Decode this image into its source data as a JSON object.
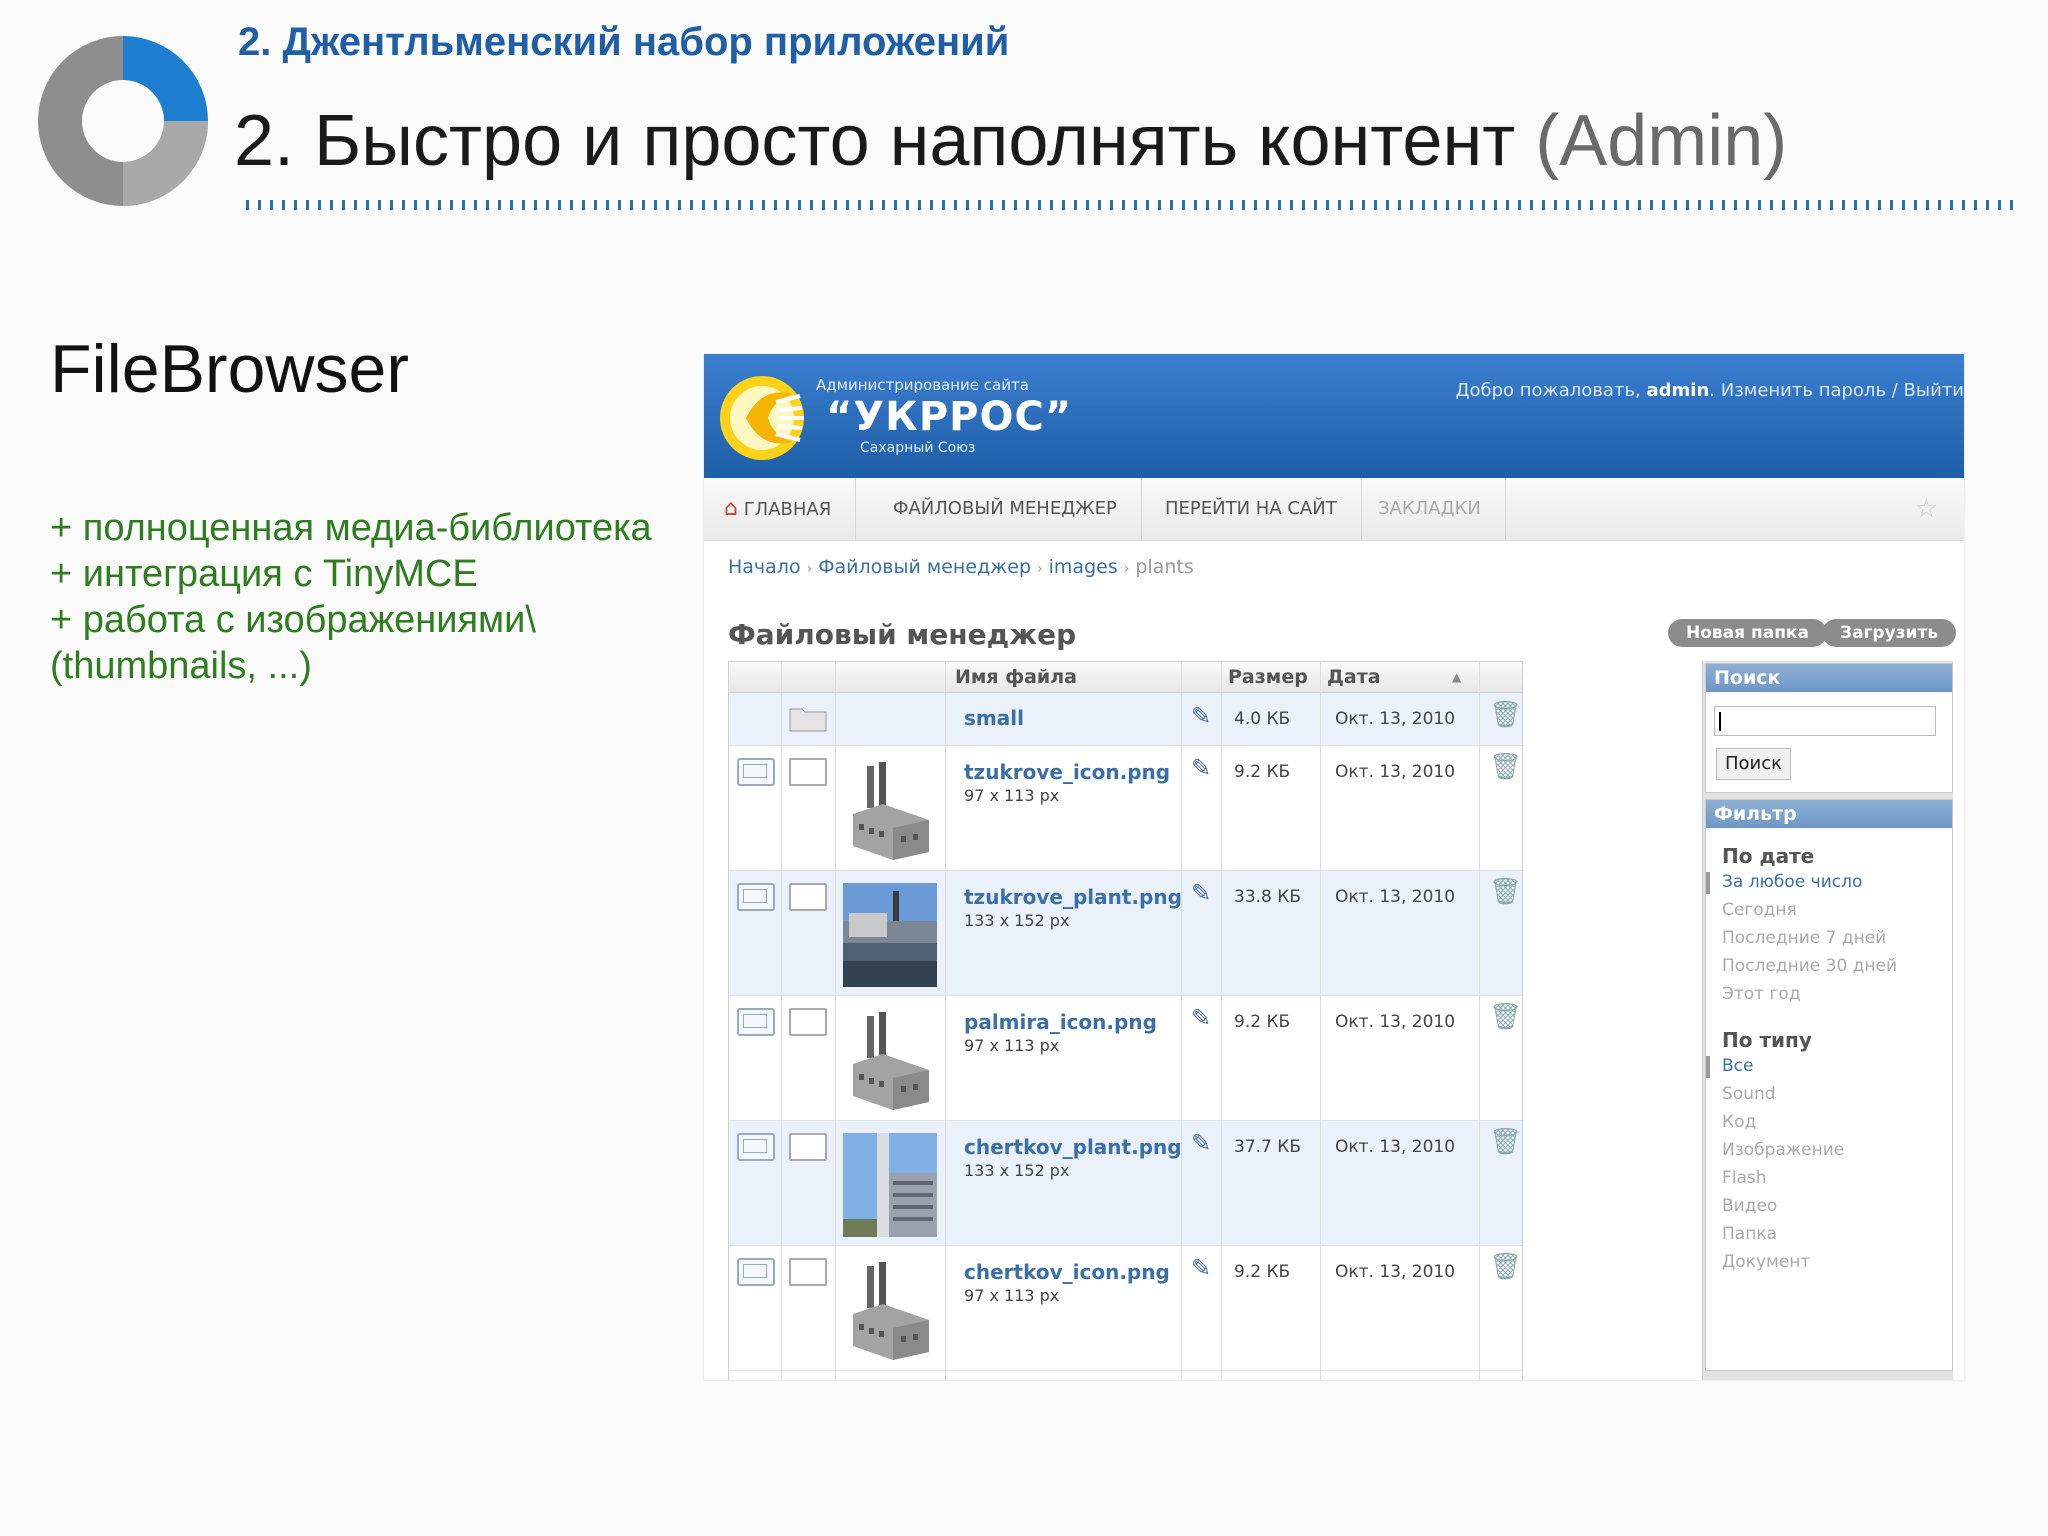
{
  "slide": {
    "subtitle": "2. Джентльменский набор приложений",
    "title_main": "2. Быстро и просто наполнять контент ",
    "title_suffix": "(Admin)",
    "heading": "FileBrowser",
    "bullets": [
      "+ полноценная медиа-библиотека",
      "+ интеграция с TinyMCE",
      "+ работа с изображениями\\",
      "(thumbnails, ...)"
    ],
    "colors": {
      "subtitle": "#1f5fa8",
      "bullets": "#2e7d1e",
      "accent": "#1e7fd0"
    }
  },
  "admin": {
    "header": {
      "caption": "Администрирование сайта",
      "brand": "“УКРРОС”",
      "tagline": "Сахарный Союз",
      "welcome_prefix": "Добро пожаловать, ",
      "user": "admin",
      "welcome_links": ". Изменить пароль / Выйти"
    },
    "nav": {
      "home": "ГЛАВНАЯ",
      "file_manager": "ФАЙЛОВЫЙ МЕНЕДЖЕР",
      "go_to_site": "ПЕРЕЙТИ НА САЙТ",
      "bookmarks": "ЗАКЛАДКИ"
    },
    "breadcrumb": [
      "Начало",
      "Файловый менеджер",
      "images",
      "plants"
    ],
    "page_title": "Файловый менеджер",
    "buttons": {
      "new_folder": "Новая папка",
      "upload": "Загрузить"
    },
    "table": {
      "headers": {
        "name": "Имя файла",
        "size": "Размер",
        "date": "Дата"
      },
      "rows": [
        {
          "name": "small",
          "dims": "",
          "size": "4.0 КБ",
          "date": "Окт. 13, 2010",
          "kind": "folder"
        },
        {
          "name": "tzukrove_icon.png",
          "dims": "97 x 113 px",
          "size": "9.2 КБ",
          "date": "Окт. 13, 2010",
          "kind": "factory"
        },
        {
          "name": "tzukrove_plant.png",
          "dims": "133 x 152 px",
          "size": "33.8 КБ",
          "date": "Окт. 13, 2010",
          "kind": "photo-plant"
        },
        {
          "name": "palmira_icon.png",
          "dims": "97 x 113 px",
          "size": "9.2 КБ",
          "date": "Окт. 13, 2010",
          "kind": "factory"
        },
        {
          "name": "chertkov_plant.png",
          "dims": "133 x 152 px",
          "size": "37.7 КБ",
          "date": "Окт. 13, 2010",
          "kind": "photo-tower"
        },
        {
          "name": "chertkov_icon.png",
          "dims": "97 x 113 px",
          "size": "9.2 КБ",
          "date": "Окт. 13, 2010",
          "kind": "factory"
        }
      ]
    },
    "search": {
      "title": "Поиск",
      "button": "Поиск",
      "value": ""
    },
    "filter": {
      "title": "Фильтр",
      "by_date": "По дате",
      "dates": [
        "За любое число",
        "Сегодня",
        "Последние 7 дней",
        "Последние 30 дней",
        "Этот год"
      ],
      "by_type": "По типу",
      "types": [
        "Все",
        "Sound",
        "Код",
        "Изображение",
        "Flash",
        "Видео",
        "Папка",
        "Документ"
      ]
    }
  }
}
